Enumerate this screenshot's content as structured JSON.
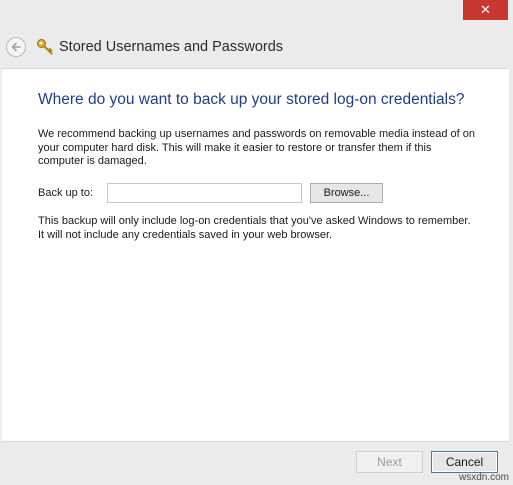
{
  "window": {
    "title": "Stored Usernames and Passwords",
    "close_glyph": "✕"
  },
  "main": {
    "heading": "Where do you want to back up your stored log-on credentials?",
    "description": "We recommend backing up usernames and passwords on removable media instead of on your computer hard disk. This will make it easier to restore or transfer them if this computer is damaged.",
    "backup_label": "Back up to:",
    "backup_value": "",
    "browse_label": "Browse...",
    "note": "This backup will only  include log-on credentials that you've asked Windows to remember. It will not include any credentials saved in your web browser."
  },
  "footer": {
    "next_label": "Next",
    "cancel_label": "Cancel",
    "next_enabled": false
  },
  "watermark": "wsxdn.com",
  "icons": {
    "back": "back-arrow-icon",
    "key": "key-icon",
    "close": "close-icon"
  },
  "colors": {
    "heading": "#1e3d8c",
    "close_button": "#c7372f",
    "key_gold": "#d9a22a",
    "cancel_border": "#3c7fb1"
  }
}
